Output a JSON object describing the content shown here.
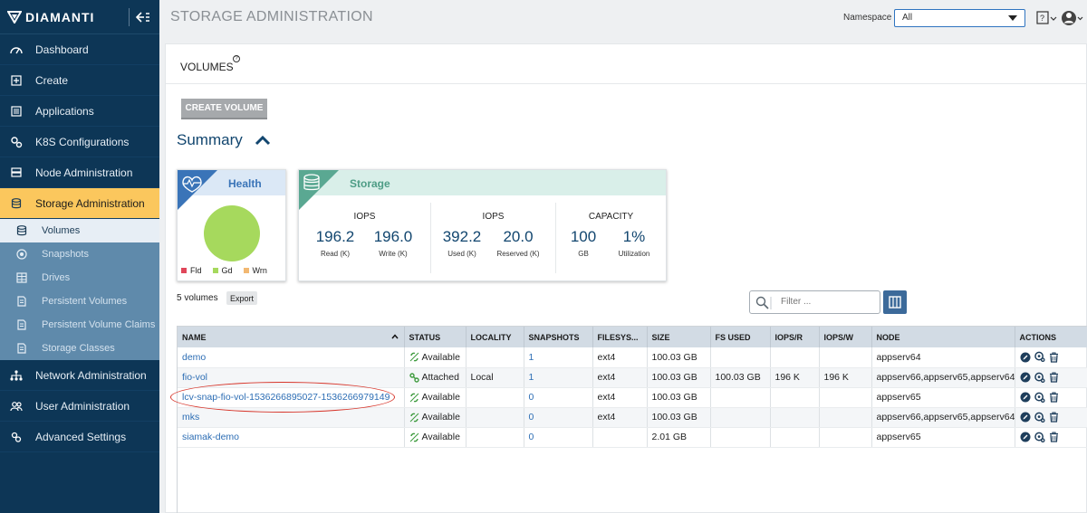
{
  "brand": {
    "name": "DIAMANTI"
  },
  "sidebar": {
    "items": [
      {
        "label": "Dashboard",
        "icon": "dashboard-icon"
      },
      {
        "label": "Create",
        "icon": "plus-square-icon"
      },
      {
        "label": "Applications",
        "icon": "list-icon"
      },
      {
        "label": "K8S Configurations",
        "icon": "gears-icon"
      },
      {
        "label": "Node Administration",
        "icon": "server-icon"
      },
      {
        "label": "Storage Administration",
        "icon": "database-icon",
        "active": true
      }
    ],
    "sub_items": [
      {
        "label": "Volumes",
        "icon": "database-icon",
        "active": true
      },
      {
        "label": "Snapshots",
        "icon": "aperture-icon"
      },
      {
        "label": "Drives",
        "icon": "grid-icon"
      },
      {
        "label": "Persistent Volumes",
        "icon": "document-icon"
      },
      {
        "label": "Persistent Volume Claims",
        "icon": "document-icon"
      },
      {
        "label": "Storage Classes",
        "icon": "document-icon"
      }
    ],
    "items_after": [
      {
        "label": "Network Administration",
        "icon": "network-icon"
      },
      {
        "label": "User Administration",
        "icon": "users-icon"
      },
      {
        "label": "Advanced Settings",
        "icon": "settings-icon"
      }
    ]
  },
  "header": {
    "title": "STORAGE ADMINISTRATION",
    "namespace_label": "Namespace",
    "namespace_value": "All"
  },
  "volumes": {
    "title": "VOLUMES",
    "create_button": "CREATE VOLUME",
    "summary_title": "Summary"
  },
  "health": {
    "title": "Health",
    "legend": [
      {
        "label": "Fld",
        "color": "#e0465a"
      },
      {
        "label": "Gd",
        "color": "#a6d95d"
      },
      {
        "label": "Wrn",
        "color": "#f2b872"
      }
    ]
  },
  "storage": {
    "title": "Storage",
    "groups": [
      {
        "label": "IOPS",
        "metrics": [
          {
            "value": "196.2",
            "sub": "Read (K)"
          },
          {
            "value": "196.0",
            "sub": "Write (K)"
          }
        ]
      },
      {
        "label": "IOPS",
        "metrics": [
          {
            "value": "392.2",
            "sub": "Used (K)"
          },
          {
            "value": "20.0",
            "sub": "Reserved (K)"
          }
        ]
      },
      {
        "label": "CAPACITY",
        "metrics": [
          {
            "value": "100",
            "sub": "GB"
          },
          {
            "value": "1%",
            "sub": "Utilization"
          }
        ]
      }
    ]
  },
  "table_controls": {
    "count_text": "5 volumes",
    "export_label": "Export",
    "filter_placeholder": "Filter ..."
  },
  "table": {
    "columns": [
      "NAME",
      "STATUS",
      "LOCALITY",
      "SNAPSHOTS",
      "FILESYS...",
      "SIZE",
      "FS USED",
      "IOPS/R",
      "IOPS/W",
      "NODE",
      "ACTIONS"
    ],
    "rows": [
      {
        "name": "demo",
        "status": "Available",
        "status_kind": "available",
        "locality": "",
        "snapshots": "1",
        "filesys": "ext4",
        "size": "100.03 GB",
        "fs_used": "",
        "iops_r": "",
        "iops_w": "",
        "node": "appserv64"
      },
      {
        "name": "fio-vol",
        "status": "Attached",
        "status_kind": "attached",
        "locality": "Local",
        "snapshots": "1",
        "filesys": "ext4",
        "size": "100.03 GB",
        "fs_used": "100.03 GB",
        "iops_r": "196 K",
        "iops_w": "196 K",
        "node": "appserv66,appserv65,appserv64"
      },
      {
        "name": "lcv-snap-fio-vol-1536266895027-1536266979149",
        "status": "Available",
        "status_kind": "available",
        "locality": "",
        "snapshots": "0",
        "filesys": "ext4",
        "size": "100.03 GB",
        "fs_used": "",
        "iops_r": "",
        "iops_w": "",
        "node": "appserv65"
      },
      {
        "name": "mks",
        "status": "Available",
        "status_kind": "available",
        "locality": "",
        "snapshots": "0",
        "filesys": "ext4",
        "size": "100.03 GB",
        "fs_used": "",
        "iops_r": "",
        "iops_w": "",
        "node": "appserv66,appserv65,appserv64"
      },
      {
        "name": "siamak-demo",
        "status": "Available",
        "status_kind": "available",
        "locality": "",
        "snapshots": "0",
        "filesys": "",
        "size": "2.01 GB",
        "fs_used": "",
        "iops_r": "",
        "iops_w": "",
        "node": "appserv65"
      }
    ]
  },
  "colors": {
    "sidebar_bg": "#0d3656",
    "active_nav": "#fbc75d",
    "link": "#2c6db4",
    "annotation": "#d7352a"
  }
}
